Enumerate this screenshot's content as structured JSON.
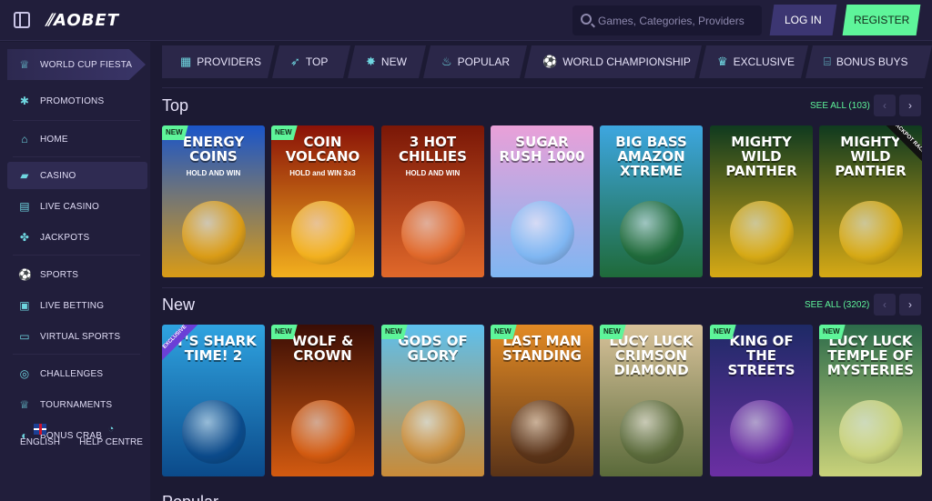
{
  "header": {
    "logo": "AOBET",
    "search_placeholder": "Games, Categories, Providers",
    "login_label": "LOG IN",
    "register_label": "REGISTER"
  },
  "sidebar": {
    "promo_label": "WORLD CUP FIESTA",
    "items": [
      {
        "label": "PROMOTIONS",
        "icon": "gear-icon"
      },
      {
        "label": "HOME",
        "icon": "home-icon"
      },
      {
        "label": "CASINO",
        "icon": "casino-icon",
        "active": true
      },
      {
        "label": "LIVE CASINO",
        "icon": "cards-icon"
      },
      {
        "label": "JACKPOTS",
        "icon": "jackpot-icon"
      },
      {
        "label": "SPORTS",
        "icon": "sports-icon"
      },
      {
        "label": "LIVE BETTING",
        "icon": "live-icon"
      },
      {
        "label": "VIRTUAL SPORTS",
        "icon": "screen-icon"
      },
      {
        "label": "CHALLENGES",
        "icon": "target-icon"
      },
      {
        "label": "TOURNAMENTS",
        "icon": "trophy-icon"
      },
      {
        "label": "BONUS CRAB",
        "icon": "crab-icon"
      }
    ],
    "language_label": "ENGLISH",
    "help_label": "HELP CENTRE"
  },
  "categories": [
    {
      "label": "PROVIDERS",
      "icon": "grid-icon"
    },
    {
      "label": "TOP",
      "icon": "rocket-icon"
    },
    {
      "label": "NEW",
      "icon": "new-icon"
    },
    {
      "label": "POPULAR",
      "icon": "flame-icon"
    },
    {
      "label": "WORLD CHAMPIONSHIP",
      "icon": "ball-icon"
    },
    {
      "label": "EXCLUSIVE",
      "icon": "crown-icon"
    },
    {
      "label": "BONUS BUYS",
      "icon": "gift-icon"
    }
  ],
  "sections": {
    "top": {
      "title": "Top",
      "see_all": "SEE ALL (103)",
      "games": [
        {
          "title": "ENERGY COINS",
          "subtitle": "HOLD AND WIN",
          "badge": "NEW",
          "colors": [
            "#1a55c9",
            "#d99b16"
          ]
        },
        {
          "title": "COIN VOLCANO",
          "subtitle": "HOLD and WIN 3x3",
          "badge": "NEW",
          "colors": [
            "#8a1208",
            "#f2b01e"
          ]
        },
        {
          "title": "3 HOT CHILLIES",
          "subtitle": "HOLD AND WIN",
          "badge": "",
          "colors": [
            "#7a1707",
            "#e0682a"
          ]
        },
        {
          "title": "Sugar Rush 1000",
          "subtitle": "",
          "badge": "",
          "colors": [
            "#e9a0d8",
            "#7fb6f2"
          ]
        },
        {
          "title": "BIG BASS AMAZON XTREME",
          "subtitle": "",
          "badge": "",
          "colors": [
            "#3da6e0",
            "#1f6a3a"
          ]
        },
        {
          "title": "MIGHTY WILD PANTHER",
          "subtitle": "",
          "badge": "",
          "colors": [
            "#0f3a1f",
            "#d6a915"
          ]
        },
        {
          "title": "MIGHTY WILD PANTHER",
          "subtitle": "",
          "badge": "",
          "jackpot_tag": "JACKPOT RACE",
          "colors": [
            "#0f3a1f",
            "#d6a915"
          ]
        }
      ]
    },
    "new": {
      "title": "New",
      "see_all": "SEE ALL (3202)",
      "games": [
        {
          "title": "IT'S SHARK TIME! 2",
          "subtitle": "",
          "badge": "",
          "exclusive": "EXCLUSIVE",
          "colors": [
            "#2fa3e0",
            "#0b4a8a"
          ]
        },
        {
          "title": "WOLF & CROWN",
          "subtitle": "",
          "badge": "NEW",
          "colors": [
            "#3a0d05",
            "#d25a10"
          ]
        },
        {
          "title": "GODS OF GLORY",
          "subtitle": "",
          "badge": "NEW",
          "colors": [
            "#5dc0ee",
            "#c98b38"
          ]
        },
        {
          "title": "LAST MAN STANDING",
          "subtitle": "",
          "badge": "NEW",
          "colors": [
            "#e28a24",
            "#5a3318"
          ]
        },
        {
          "title": "Lucy Luck CRIMSON DIAMOND",
          "subtitle": "",
          "badge": "NEW",
          "colors": [
            "#d8c29a",
            "#5a6a3a"
          ]
        },
        {
          "title": "KING OF THE STREETS",
          "subtitle": "",
          "badge": "NEW",
          "colors": [
            "#1e2a66",
            "#6b2fa3"
          ]
        },
        {
          "title": "Lucy Luck Temple of Mysteries",
          "subtitle": "",
          "badge": "NEW",
          "colors": [
            "#2c6b4a",
            "#c9d27a"
          ]
        }
      ]
    },
    "next_title": "Popular"
  }
}
